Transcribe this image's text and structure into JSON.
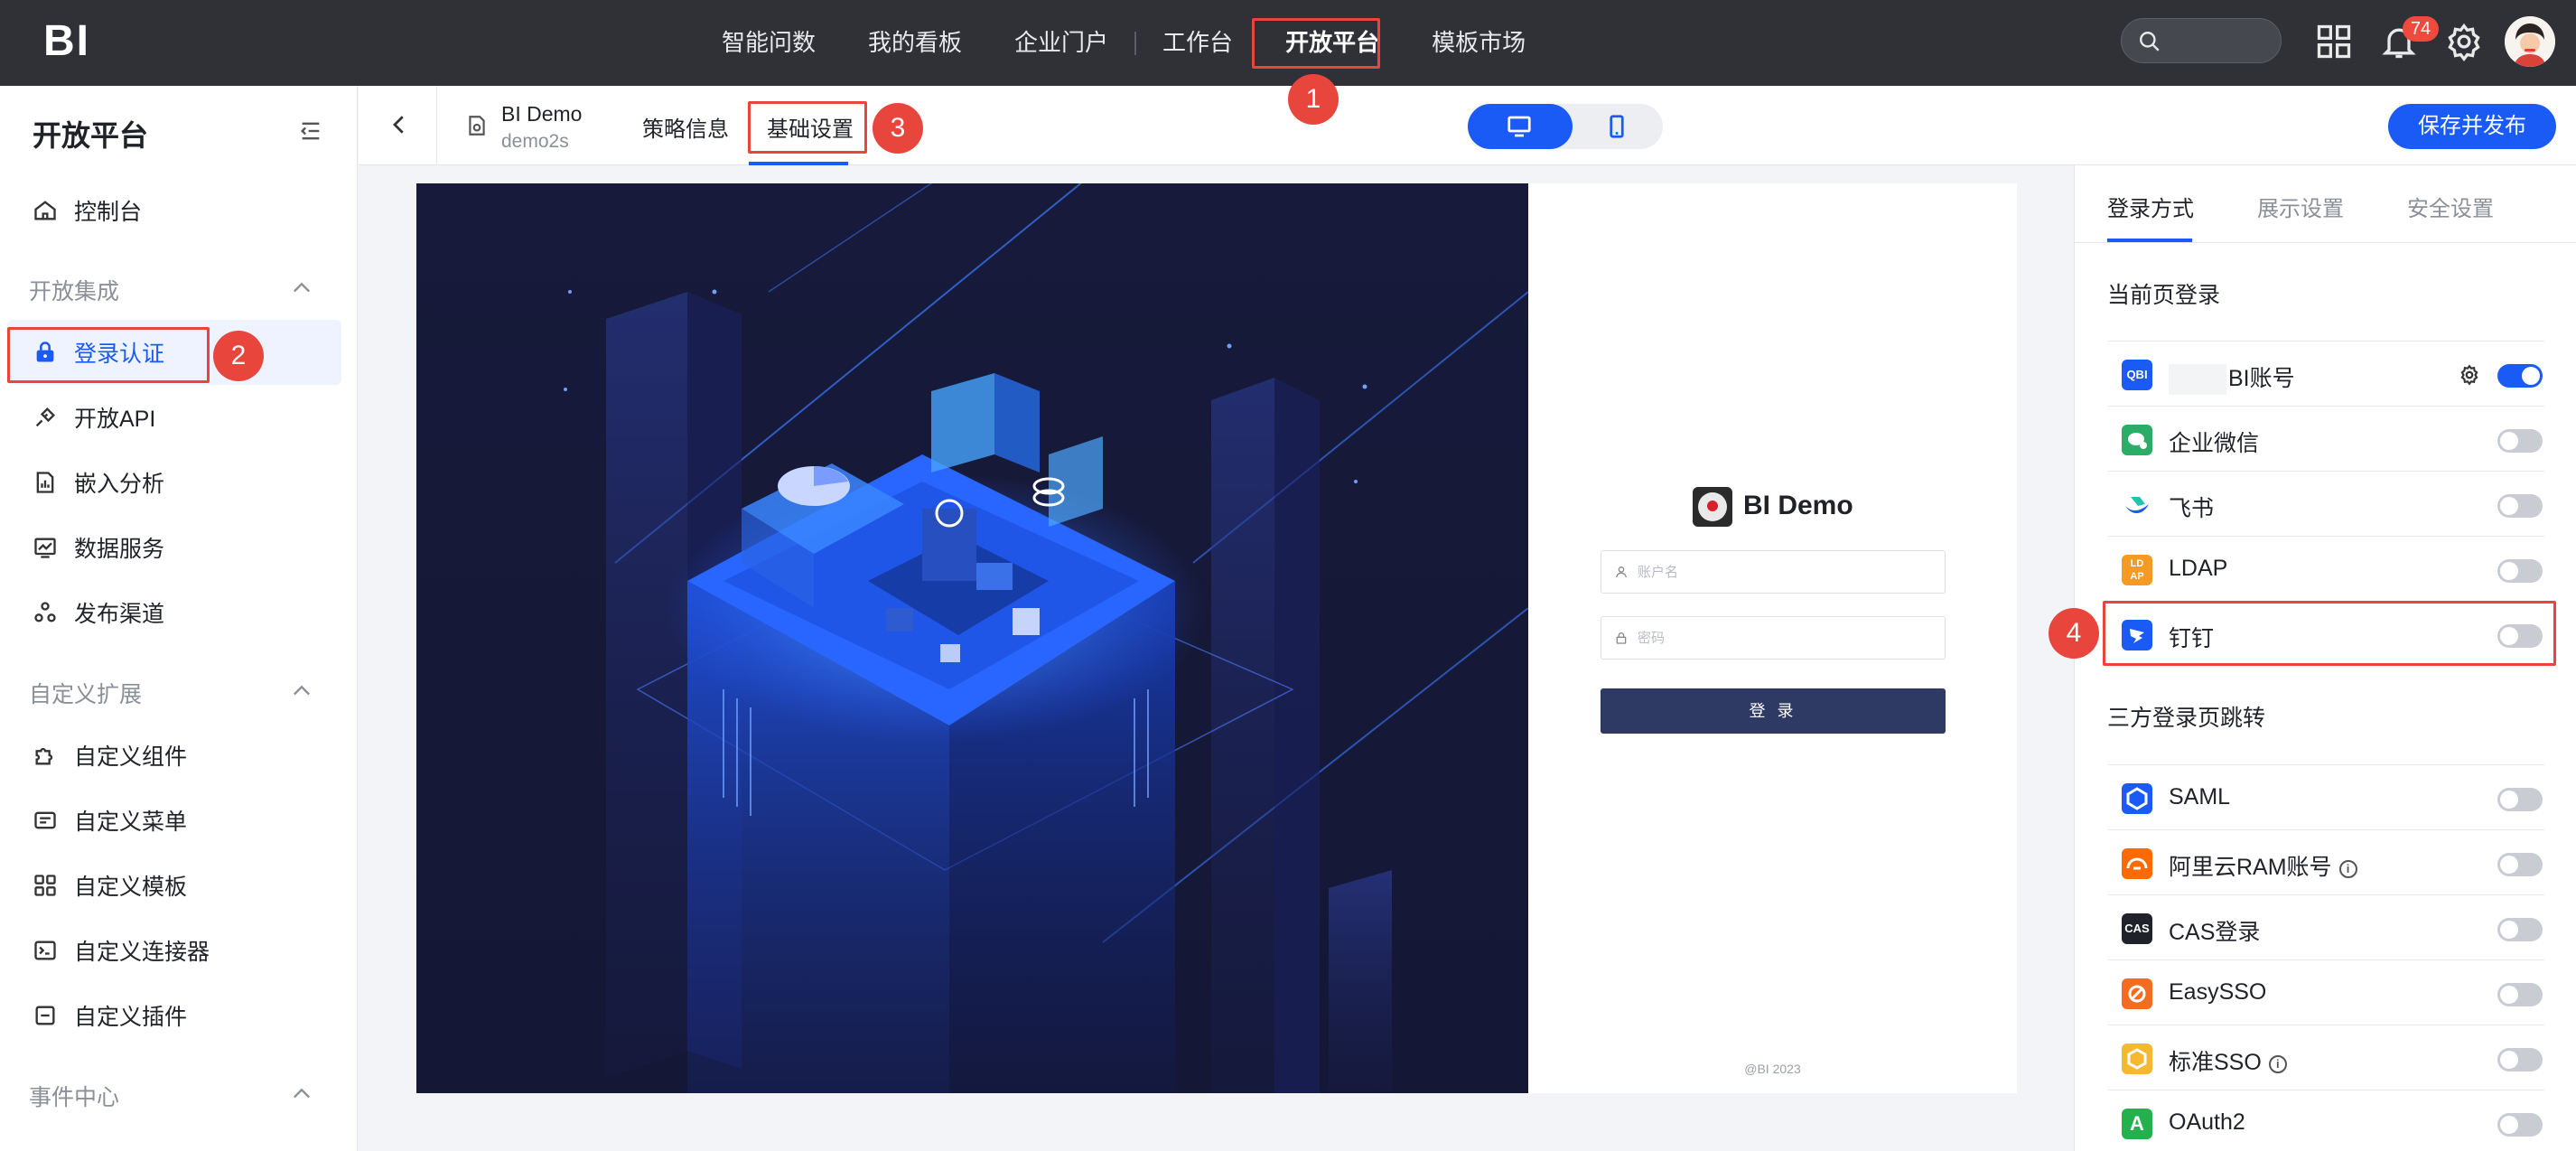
{
  "topbar": {
    "logo": "BI",
    "nav": [
      "智能问数",
      "我的看板",
      "企业门户",
      "工作台",
      "开放平台",
      "模板市场"
    ],
    "active_nav": "开放平台",
    "notification_count": "74"
  },
  "sidebar": {
    "title": "开放平台",
    "console": "控制台",
    "groups": {
      "integration": "开放集成",
      "custom": "自定义扩展",
      "events": "事件中心"
    },
    "integration_items": [
      "登录认证",
      "开放API",
      "嵌入分析",
      "数据服务",
      "发布渠道"
    ],
    "custom_items": [
      "自定义组件",
      "自定义菜单",
      "自定义模板",
      "自定义连接器",
      "自定义插件"
    ]
  },
  "subhead": {
    "demo_name": "BI Demo",
    "demo_sub": "demo2s",
    "tabs": [
      "策略信息",
      "基础设置"
    ],
    "active_tab": "基础设置",
    "publish": "保存并发布"
  },
  "preview": {
    "title": "BI Demo",
    "username_placeholder": "账户名",
    "password_placeholder": "密码",
    "login_button": "登 录",
    "footer": "@BI 2023"
  },
  "right_panel": {
    "tabs": [
      "登录方式",
      "展示设置",
      "安全设置"
    ],
    "active_tab": "登录方式",
    "current_section": "当前页登录",
    "current_items": [
      {
        "label": "BI账号",
        "logo": "QBI",
        "color": "#1a5bf5",
        "on": true
      },
      {
        "label": "企业微信",
        "logo": "wecom",
        "color": "#2aae67",
        "on": false
      },
      {
        "label": "飞书",
        "logo": "feishu",
        "color": "#ffffff",
        "on": false
      },
      {
        "label": "LDAP",
        "logo": "LD AP",
        "color": "#f59a23",
        "on": false
      },
      {
        "label": "钉钉",
        "logo": "dingtalk",
        "color": "#1a5bf5",
        "on": false
      }
    ],
    "third_section": "三方登录页跳转",
    "third_items": [
      {
        "label": "SAML",
        "logo": "saml",
        "color": "#1a5bf5",
        "on": false,
        "info": false
      },
      {
        "label": "阿里云RAM账号",
        "logo": "aliyun",
        "color": "#ff6a00",
        "on": false,
        "info": true
      },
      {
        "label": "CAS登录",
        "logo": "CAS",
        "color": "#1f2329",
        "on": false,
        "info": false
      },
      {
        "label": "EasySSO",
        "logo": "easy",
        "color": "#f56c1e",
        "on": false,
        "info": false
      },
      {
        "label": "标准SSO",
        "logo": "sso",
        "color": "#f5b82e",
        "on": false,
        "info": true
      },
      {
        "label": "OAuth2",
        "logo": "A",
        "color": "#22b14c",
        "on": false,
        "info": false
      }
    ]
  },
  "annotations": [
    "1",
    "2",
    "3",
    "4"
  ]
}
